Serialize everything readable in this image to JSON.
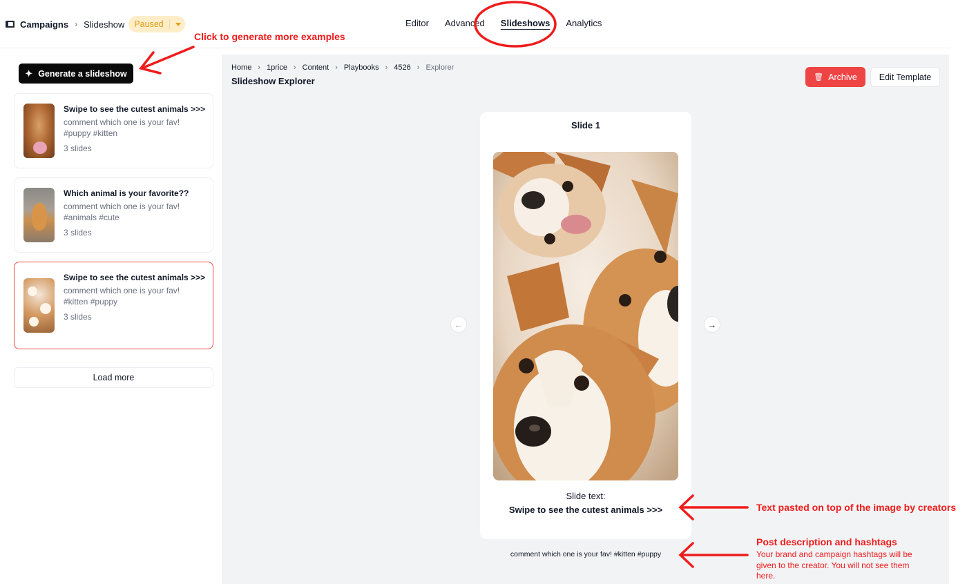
{
  "header": {
    "app_title": "Campaigns",
    "crumb": "Slideshow",
    "status": "Paused",
    "tabs": [
      {
        "label": "Editor"
      },
      {
        "label": "Advanced"
      },
      {
        "label": "Slideshows"
      },
      {
        "label": "Analytics"
      }
    ]
  },
  "sidebar": {
    "generate_label": "Generate a slideshow",
    "load_more_label": "Load more",
    "cards": [
      {
        "title": "Swipe to see the cutest animals >>>",
        "desc_line1": "comment which one is your fav!",
        "desc_line2": "#puppy #kitten",
        "count": "3 slides"
      },
      {
        "title": "Which animal is your favorite??",
        "desc_line1": "comment which one is your fav!",
        "desc_line2": "#animals #cute",
        "count": "3 slides"
      },
      {
        "title": "Swipe to see the cutest animals >>>",
        "desc_line1": "comment which one is your fav!",
        "desc_line2": "#kitten #puppy",
        "count": "3 slides"
      }
    ]
  },
  "main": {
    "breadcrumb": [
      "Home",
      "1price",
      "Content",
      "Playbooks",
      "4526",
      "Explorer"
    ],
    "title": "Slideshow Explorer",
    "archive_label": "Archive",
    "edit_template_label": "Edit Template",
    "slide": {
      "label": "Slide 1",
      "text_label": "Slide text:",
      "text": "Swipe to see the cutest animals >>>"
    },
    "post_description": "comment which one is your fav! #kitten #puppy"
  },
  "annotations": {
    "generate_hint": "Click to generate more examples",
    "slide_text_hint": "Text pasted on top of the image by creators",
    "post_desc_title": "Post description and hashtags",
    "post_desc_body": "Your brand and campaign hashtags will be given to the creator. You will not see them here.",
    "color": "#ef1c1c"
  },
  "colors": {
    "status_bg": "#fdedc8",
    "status_text": "#e0a018",
    "archive": "#ef4444",
    "selected_border": "#ef4444"
  },
  "icons": {
    "brand": "square-logo-icon",
    "generate": "magic-wand-icon",
    "archive": "trash-icon",
    "prev": "arrow-left-icon",
    "next": "arrow-right-icon"
  }
}
